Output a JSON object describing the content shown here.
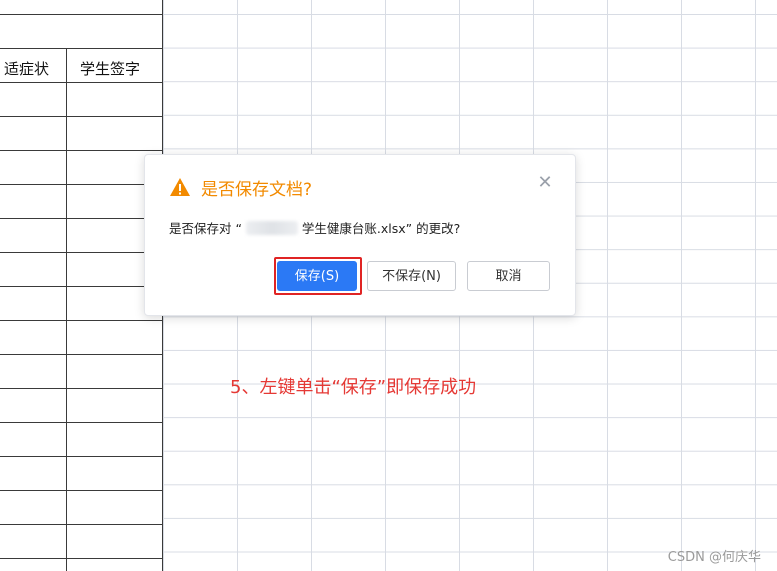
{
  "table": {
    "header_col1": "适症状",
    "header_col2": "学生签字"
  },
  "dialog": {
    "title": "是否保存文档?",
    "message_prefix": "是否保存对 “",
    "message_suffix": "学生健康台账.xlsx” 的更改?",
    "save_label": "保存(S)",
    "no_save_label": "不保存(N)",
    "cancel_label": "取消",
    "warning_color": "#f28a00",
    "primary_color": "#2b79f5"
  },
  "annotation": {
    "text": "5、左键单击“保存”即保存成功",
    "color": "#e53935"
  },
  "watermark": "CSDN @何庆华",
  "icons": {
    "warning": "warning-icon",
    "close": "close-icon"
  }
}
